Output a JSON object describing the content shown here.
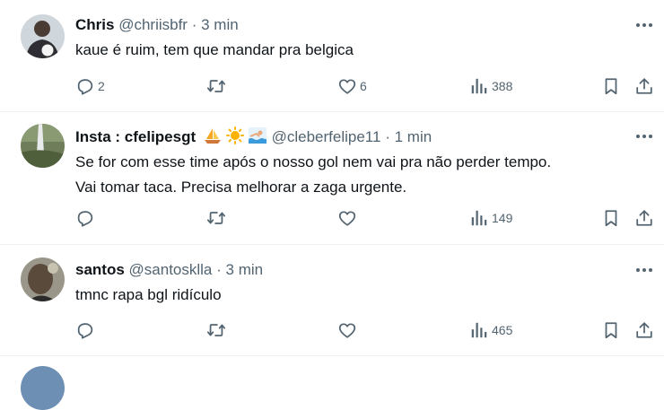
{
  "tweets": [
    {
      "name": "Chris",
      "handle": "@chriisbfr",
      "time": "3 min",
      "text": [
        "kaue é ruim, tem que mandar pra belgica"
      ],
      "replies": "2",
      "retweets": "",
      "likes": "6",
      "views": "388"
    },
    {
      "name": "Insta : cfelipesgt",
      "handle": "@cleberfelipe11",
      "time": "1 min",
      "text": [
        "Se for com esse time após o nosso gol nem vai pra não perder tempo.",
        "Vai tomar taca. Precisa melhorar a zaga urgente."
      ],
      "replies": "",
      "retweets": "",
      "likes": "",
      "views": "149"
    },
    {
      "name": "santos",
      "handle": "@santosklla",
      "time": "3 min",
      "text": [
        "tmnc rapa bgl ridículo"
      ],
      "replies": "",
      "retweets": "",
      "likes": "",
      "views": "465"
    }
  ],
  "separator": "·",
  "icons": {
    "reply": "reply-icon",
    "retweet": "retweet-icon",
    "like": "heart-icon",
    "views": "views-icon",
    "bookmark": "bookmark-icon",
    "share": "share-icon",
    "more": "more-icon"
  },
  "colors": {
    "text": "#0f1419",
    "secondary": "#536471",
    "divider": "#eff3f4"
  }
}
